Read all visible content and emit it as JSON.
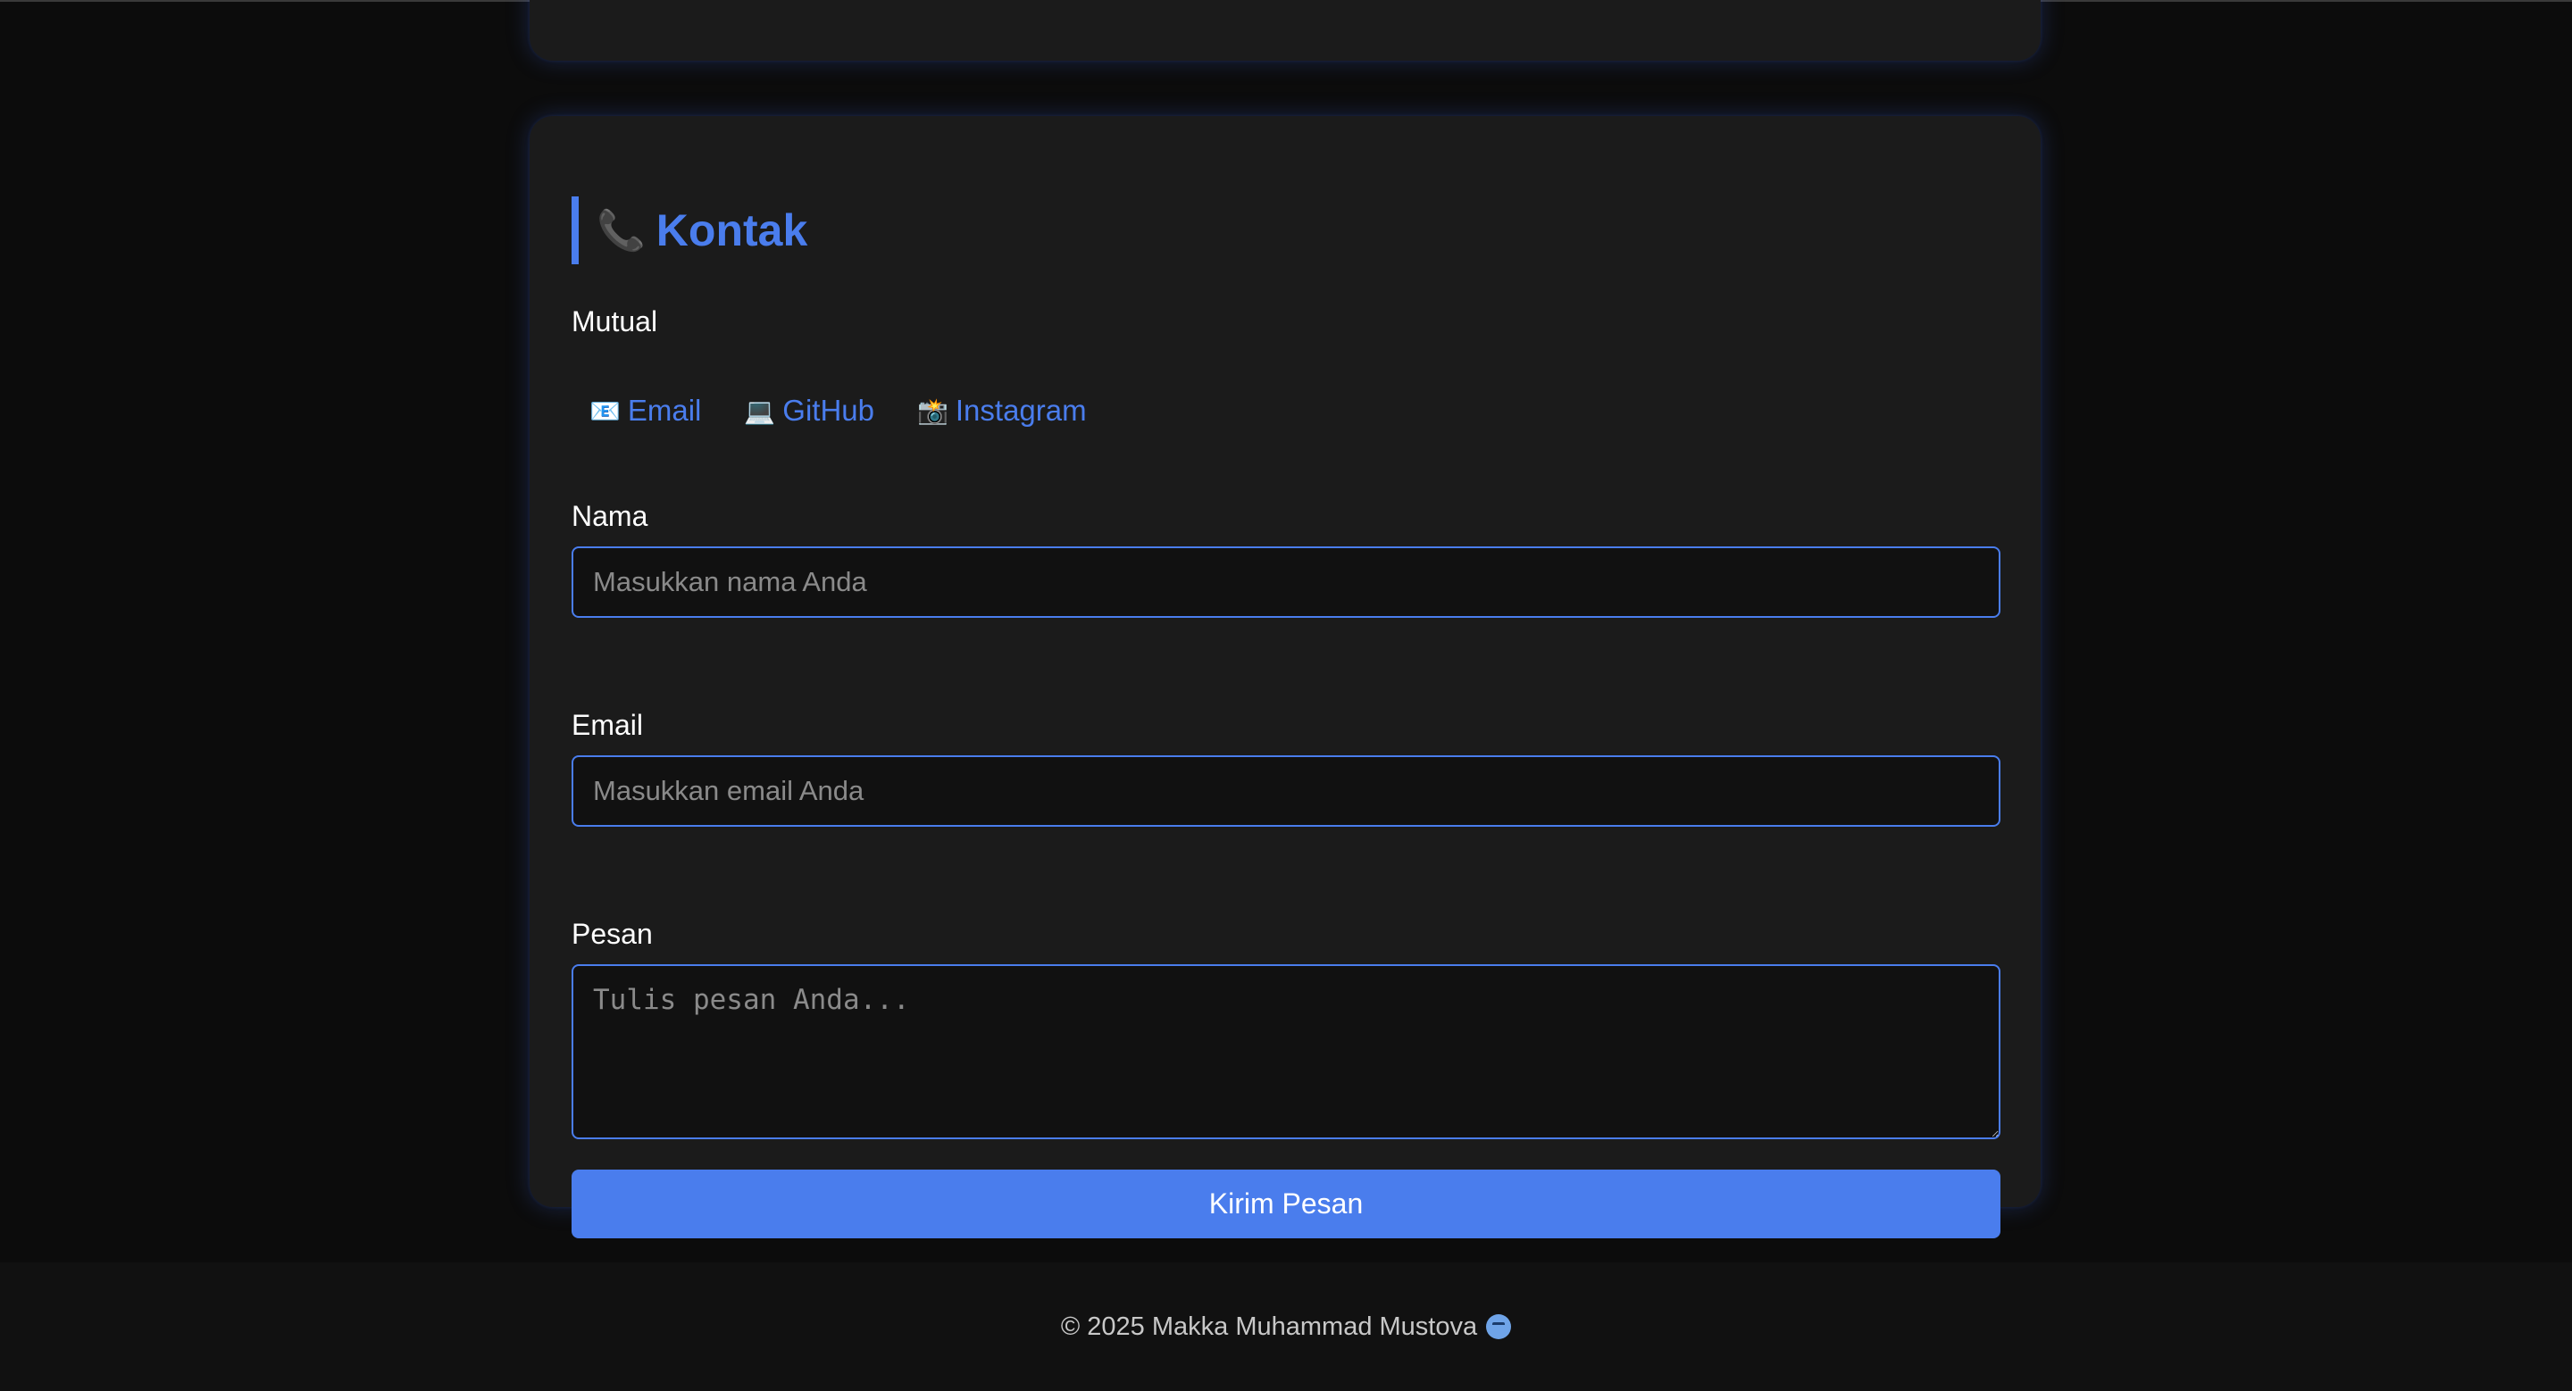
{
  "contact": {
    "title_icon": "📞",
    "title": "Kontak",
    "subtitle": "Mutual",
    "links": [
      {
        "icon": "📧",
        "label": "Email"
      },
      {
        "icon": "💻",
        "label": "GitHub"
      },
      {
        "icon": "📸",
        "label": "Instagram"
      }
    ]
  },
  "form": {
    "name_label": "Nama",
    "name_placeholder": "Masukkan nama Anda",
    "email_label": "Email",
    "email_placeholder": "Masukkan email Anda",
    "message_label": "Pesan",
    "message_placeholder": "Tulis pesan Anda...",
    "submit_label": "Kirim Pesan"
  },
  "footer": {
    "text": "© 2025 Makka Muhammad Mustova",
    "icon": "cold-face-icon"
  },
  "colors": {
    "accent": "#4a7ded",
    "background": "#0c0c0c",
    "card": "#1b1b1b",
    "footer": "#111111"
  }
}
